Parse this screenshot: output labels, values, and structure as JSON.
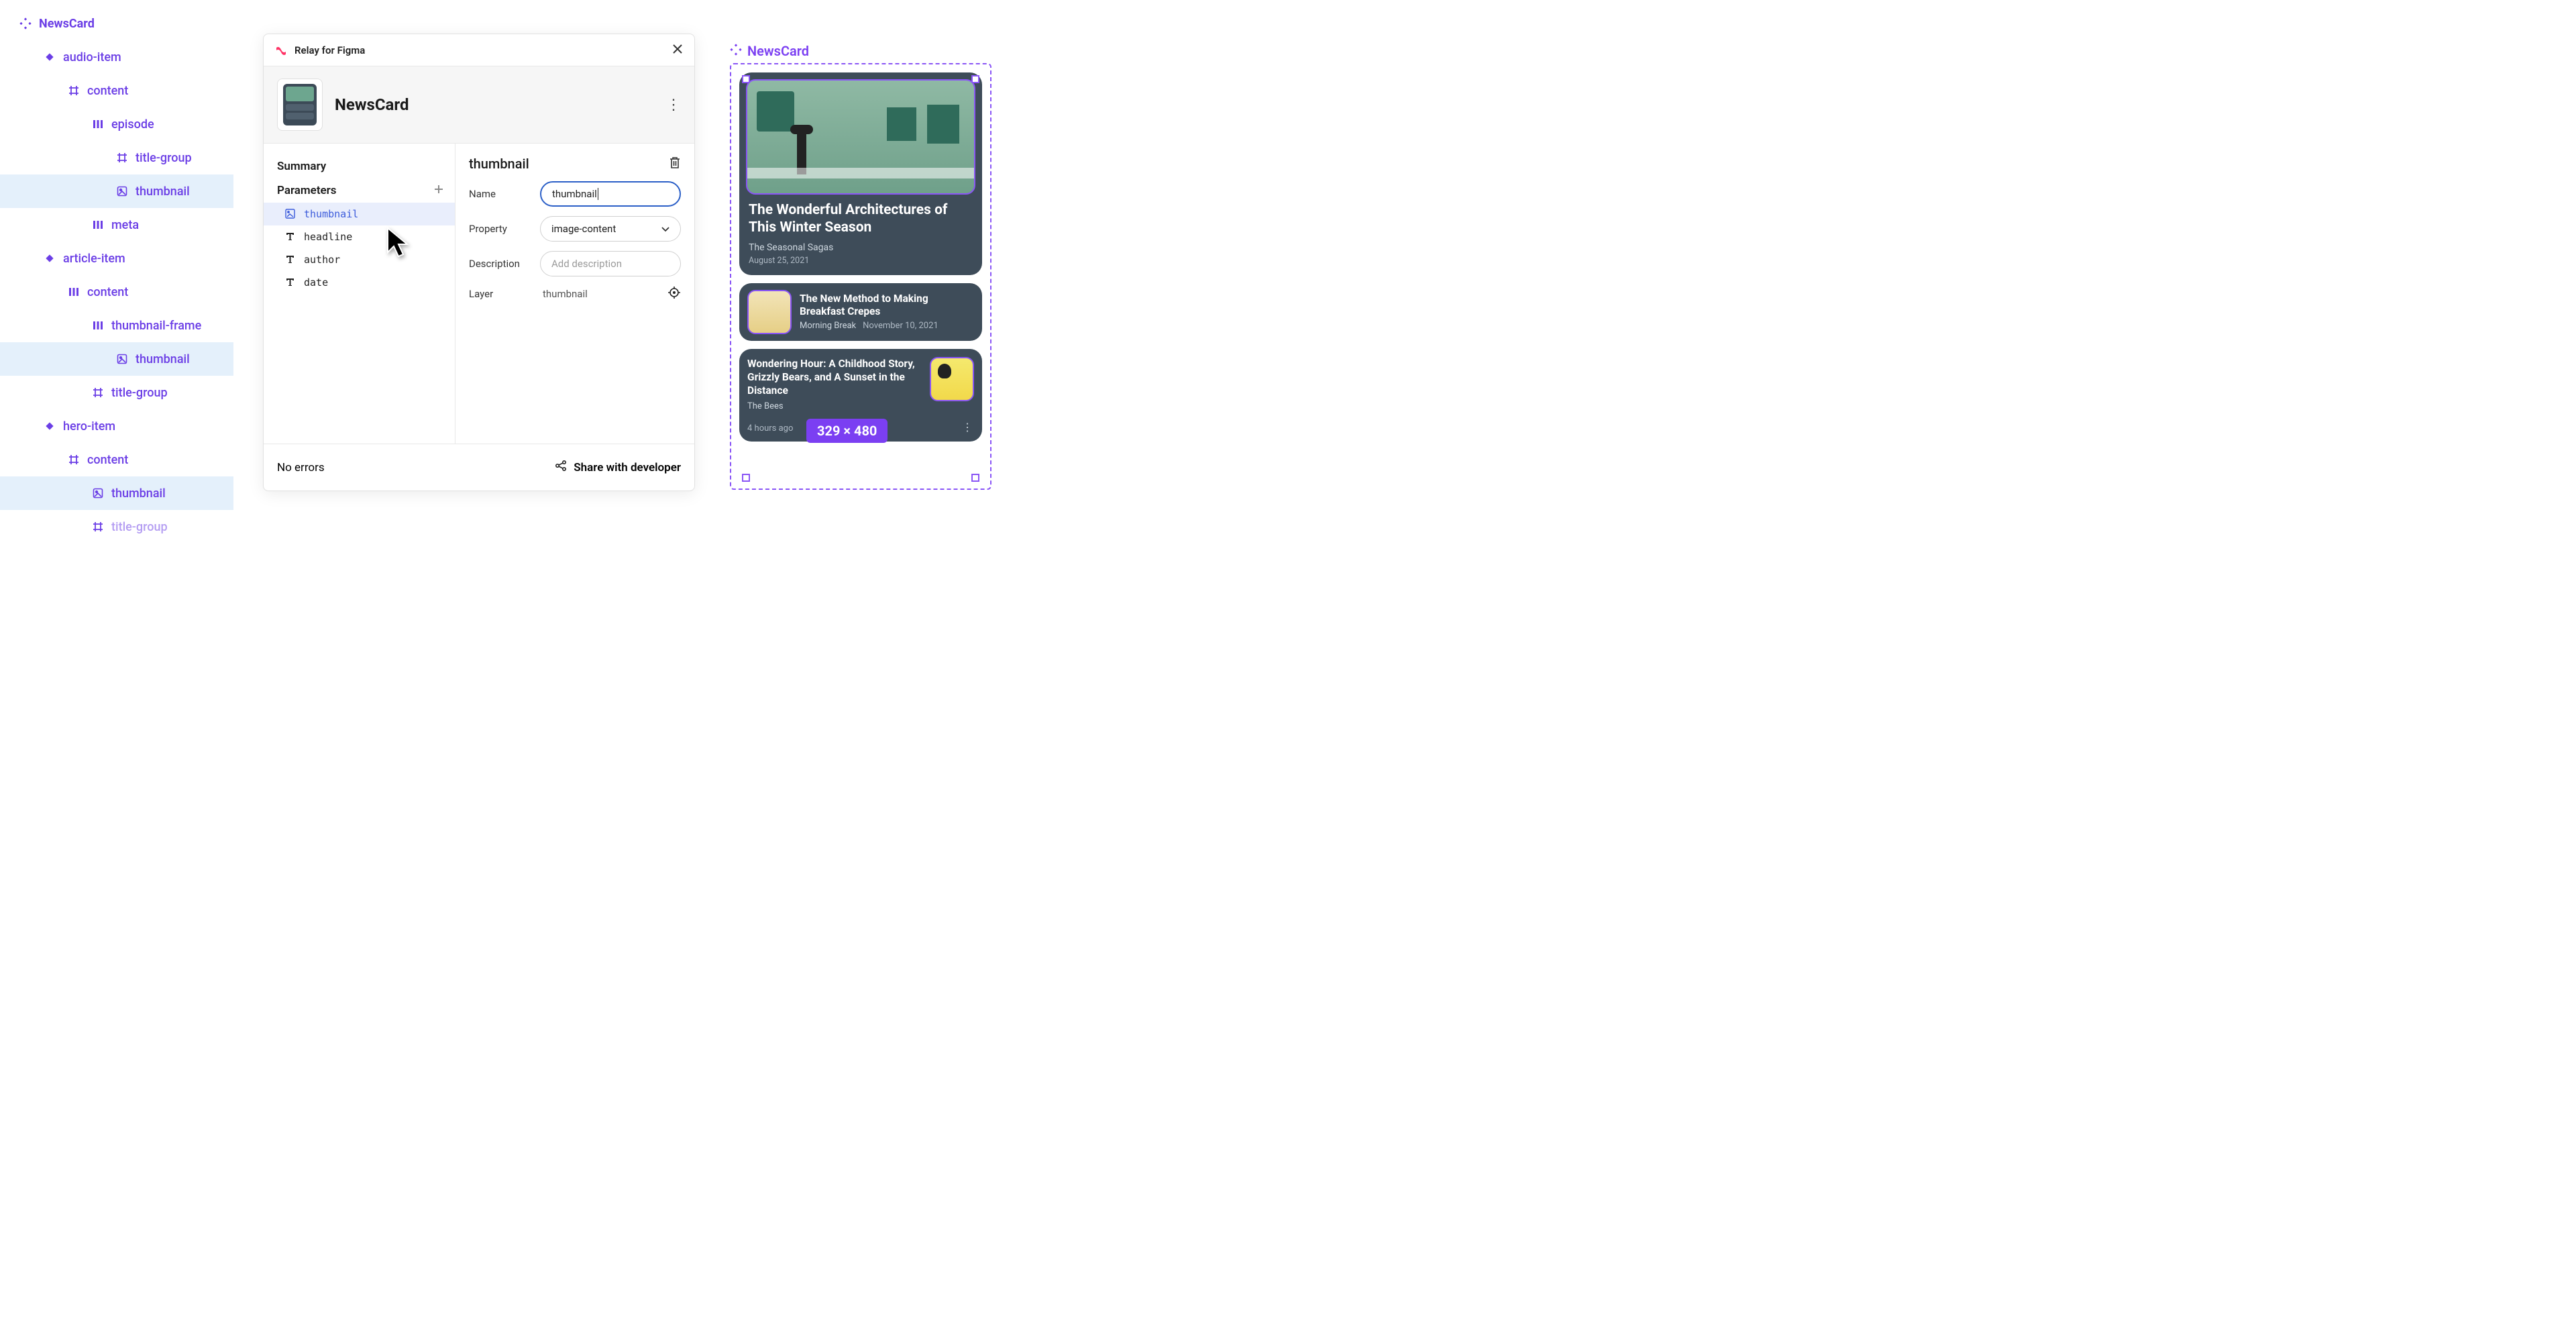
{
  "tree": {
    "root": "NewsCard",
    "items": [
      {
        "label": "audio-item",
        "icon": "diamond-solid",
        "indent": 1
      },
      {
        "label": "content",
        "icon": "frame",
        "indent": 2
      },
      {
        "label": "episode",
        "icon": "stack",
        "indent": 3
      },
      {
        "label": "title-group",
        "icon": "frame",
        "indent": 4
      },
      {
        "label": "thumbnail",
        "icon": "image",
        "indent": 4,
        "selected": true
      },
      {
        "label": "meta",
        "icon": "stack",
        "indent": 3
      },
      {
        "label": "article-item",
        "icon": "diamond-solid",
        "indent": 1
      },
      {
        "label": "content",
        "icon": "stack",
        "indent": 2
      },
      {
        "label": "thumbnail-frame",
        "icon": "stack",
        "indent": 3
      },
      {
        "label": "thumbnail",
        "icon": "image",
        "indent": 4,
        "selected": true
      },
      {
        "label": "title-group",
        "icon": "frame",
        "indent": 3
      },
      {
        "label": "hero-item",
        "icon": "diamond-solid",
        "indent": 1
      },
      {
        "label": "content",
        "icon": "frame",
        "indent": 2
      },
      {
        "label": "thumbnail",
        "icon": "image",
        "indent": 3,
        "selected": true
      },
      {
        "label": "title-group",
        "icon": "frame",
        "indent": 3,
        "faded": true
      }
    ]
  },
  "plugin": {
    "title": "Relay for Figma",
    "component_name": "NewsCard",
    "sections": {
      "summary": "Summary",
      "parameters": "Parameters"
    },
    "parameters": [
      {
        "name": "thumbnail",
        "kind": "image",
        "selected": true
      },
      {
        "name": "headline",
        "kind": "text"
      },
      {
        "name": "author",
        "kind": "text"
      },
      {
        "name": "date",
        "kind": "text"
      }
    ],
    "detail": {
      "heading": "thumbnail",
      "fields": {
        "name_label": "Name",
        "name_value": "thumbnail",
        "property_label": "Property",
        "property_value": "image-content",
        "description_label": "Description",
        "description_placeholder": "Add description",
        "layer_label": "Layer",
        "layer_value": "thumbnail"
      }
    },
    "footer": {
      "errors": "No errors",
      "share": "Share with developer"
    }
  },
  "canvas": {
    "label": "NewsCard",
    "size_badge": "329 × 480",
    "hero": {
      "headline": "The Wonderful Architectures of This Winter Season",
      "author": "The Seasonal Sagas",
      "date": "August 25, 2021"
    },
    "article": {
      "headline": "The New Method to Making Breakfast Crepes",
      "author": "Morning Break",
      "date": "November 10, 2021"
    },
    "audio": {
      "headline": "Wondering Hour: A Childhood Story, Grizzly Bears, and A Sunset in the Distance",
      "author": "The Bees",
      "time": "4 hours ago"
    }
  }
}
